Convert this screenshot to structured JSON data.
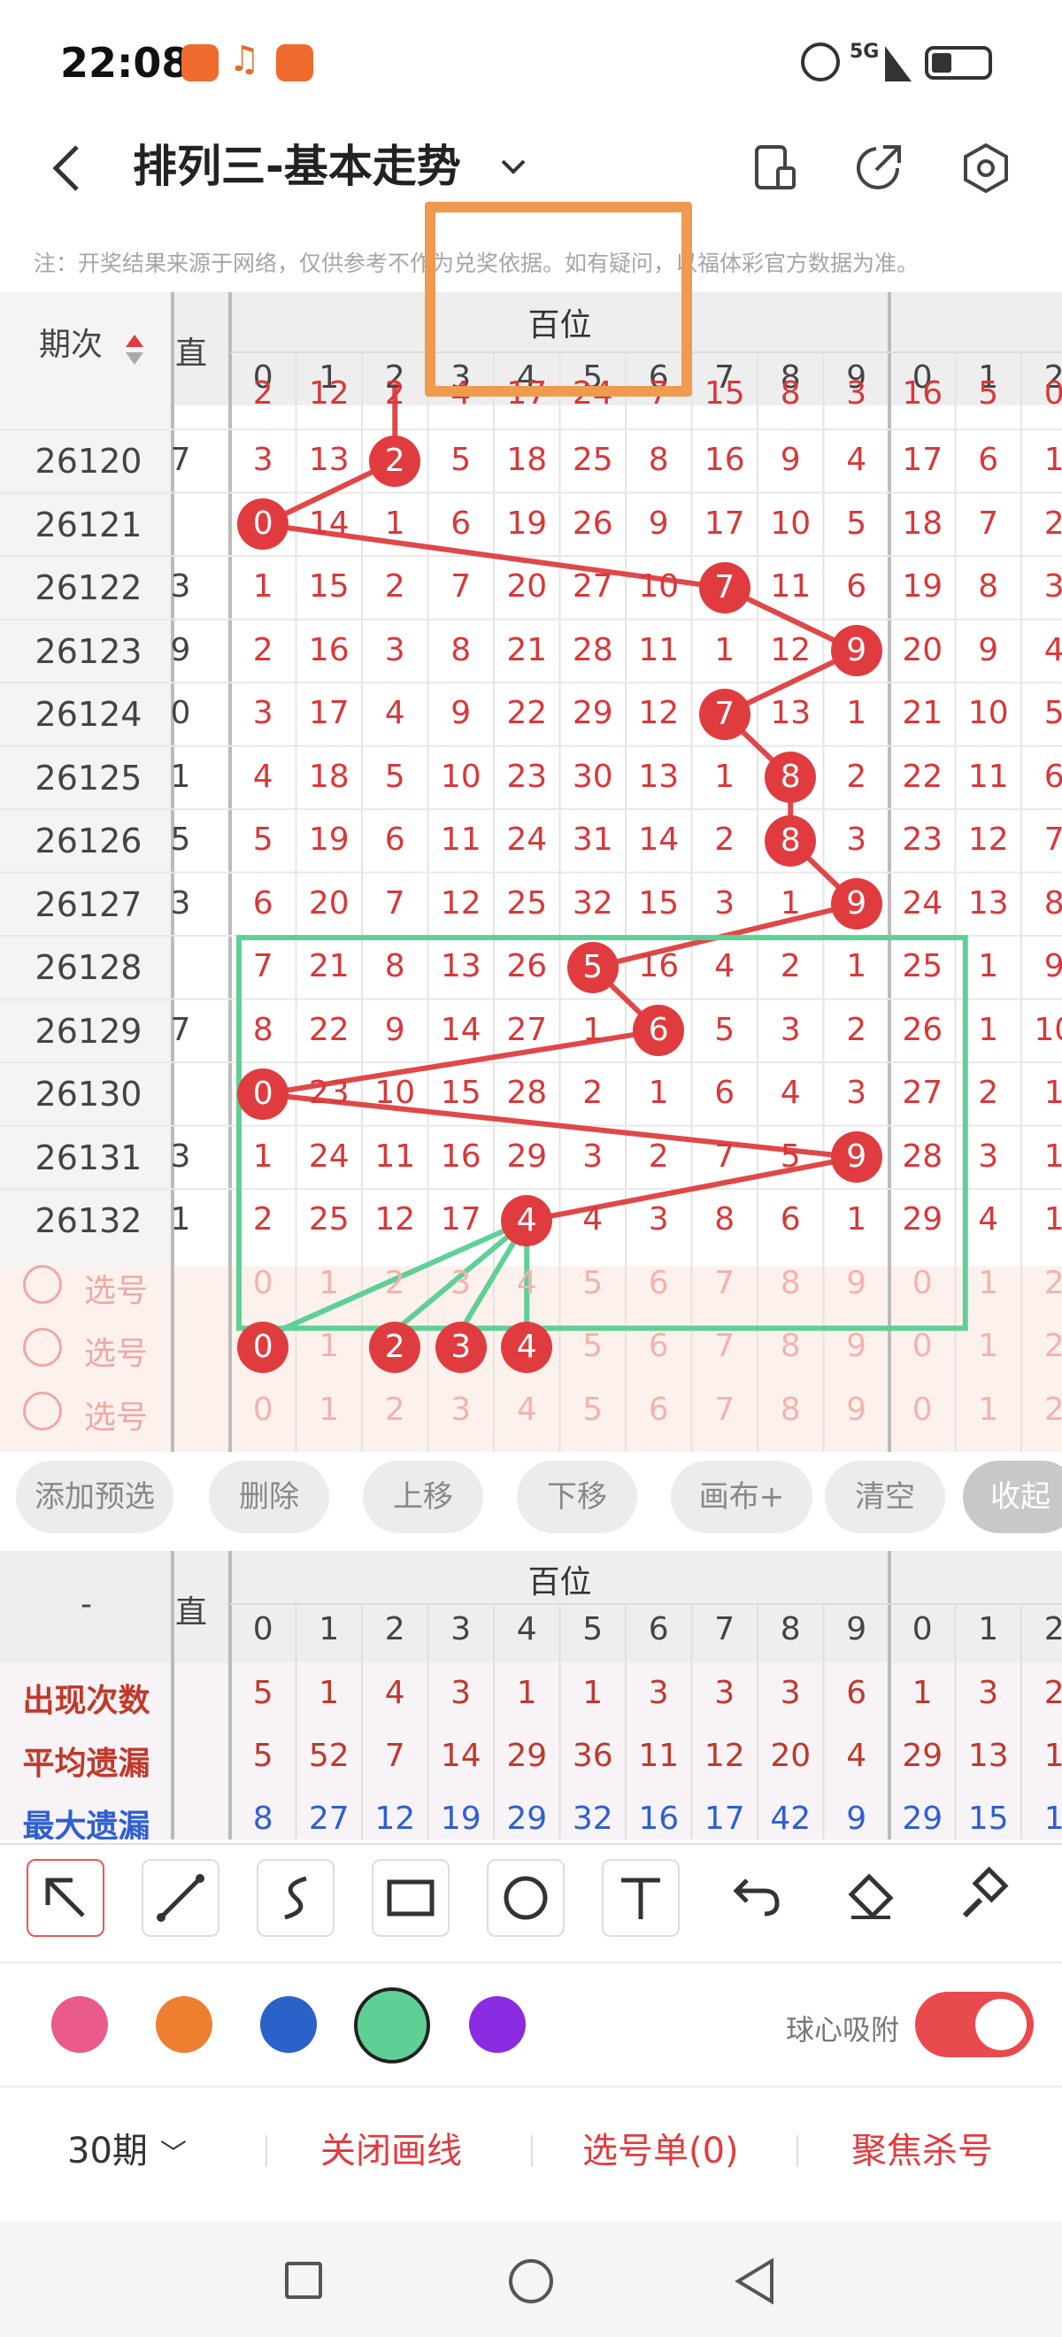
{
  "status_bar": {
    "time": "22:08",
    "network": "5G"
  },
  "header": {
    "title": "排列三-基本走势",
    "note": "注：开奖结果来源于网络，仅供参考不作为兑奖依据。如有疑问，以福体彩官方数据为准。"
  },
  "table": {
    "period_header": "期次",
    "zhi_header": "直",
    "section": "百位",
    "digits": [
      "0",
      "1",
      "2",
      "3",
      "4",
      "5",
      "6",
      "7",
      "8",
      "9"
    ],
    "next_digits": [
      "0",
      "1",
      "2"
    ],
    "partial_top": [
      "2",
      "12",
      "2",
      "4",
      "17",
      "24",
      "7",
      "15",
      "8",
      "3",
      "16",
      "5",
      "0"
    ],
    "rows": [
      {
        "period": "26120",
        "zhi": "7",
        "cells": [
          "3",
          "13",
          "2",
          "5",
          "18",
          "25",
          "8",
          "16",
          "9",
          "4",
          "17",
          "6",
          "1"
        ],
        "hit": 2
      },
      {
        "period": "26121",
        "zhi": "",
        "cells": [
          "0",
          "14",
          "1",
          "6",
          "19",
          "26",
          "9",
          "17",
          "10",
          "5",
          "18",
          "7",
          "2"
        ],
        "hit": 0
      },
      {
        "period": "26122",
        "zhi": "3",
        "cells": [
          "1",
          "15",
          "2",
          "7",
          "20",
          "27",
          "10",
          "7",
          "11",
          "6",
          "19",
          "8",
          "3"
        ],
        "hit": 7
      },
      {
        "period": "26123",
        "zhi": "9",
        "cells": [
          "2",
          "16",
          "3",
          "8",
          "21",
          "28",
          "11",
          "1",
          "12",
          "9",
          "20",
          "9",
          "4"
        ],
        "hit": 9
      },
      {
        "period": "26124",
        "zhi": "0",
        "cells": [
          "3",
          "17",
          "4",
          "9",
          "22",
          "29",
          "12",
          "7",
          "13",
          "1",
          "21",
          "10",
          "5"
        ],
        "hit": 7
      },
      {
        "period": "26125",
        "zhi": "1",
        "cells": [
          "4",
          "18",
          "5",
          "10",
          "23",
          "30",
          "13",
          "1",
          "8",
          "2",
          "22",
          "11",
          "6"
        ],
        "hit": 8
      },
      {
        "period": "26126",
        "zhi": "5",
        "cells": [
          "5",
          "19",
          "6",
          "11",
          "24",
          "31",
          "14",
          "2",
          "8",
          "3",
          "23",
          "12",
          "7"
        ],
        "hit": 8
      },
      {
        "period": "26127",
        "zhi": "3",
        "cells": [
          "6",
          "20",
          "7",
          "12",
          "25",
          "32",
          "15",
          "3",
          "1",
          "9",
          "24",
          "13",
          "8"
        ],
        "hit": 9
      },
      {
        "period": "26128",
        "zhi": "",
        "cells": [
          "7",
          "21",
          "8",
          "13",
          "26",
          "5",
          "16",
          "4",
          "2",
          "1",
          "25",
          "1",
          "9"
        ],
        "hit": 5
      },
      {
        "period": "26129",
        "zhi": "7",
        "cells": [
          "8",
          "22",
          "9",
          "14",
          "27",
          "1",
          "6",
          "5",
          "3",
          "2",
          "26",
          "1",
          "10"
        ],
        "hit": 6
      },
      {
        "period": "26130",
        "zhi": "",
        "cells": [
          "0",
          "23",
          "10",
          "15",
          "28",
          "2",
          "1",
          "6",
          "4",
          "3",
          "27",
          "2",
          "1"
        ],
        "hit": 0
      },
      {
        "period": "26131",
        "zhi": "3",
        "cells": [
          "1",
          "24",
          "11",
          "16",
          "29",
          "3",
          "2",
          "7",
          "5",
          "9",
          "28",
          "3",
          "1"
        ],
        "hit": 9
      },
      {
        "period": "26132",
        "zhi": "1",
        "cells": [
          "2",
          "25",
          "12",
          "17",
          "4",
          "4",
          "3",
          "8",
          "6",
          "1",
          "29",
          "4",
          "1"
        ],
        "hit": 4
      }
    ],
    "select_label": "选号",
    "select_rows": [
      [
        "0",
        "1",
        "2",
        "3",
        "4",
        "5",
        "6",
        "7",
        "8",
        "9",
        "0",
        "1",
        "2"
      ],
      [
        "0",
        "1",
        "2",
        "3",
        "4",
        "5",
        "6",
        "7",
        "8",
        "9",
        "0",
        "1",
        "2"
      ],
      [
        "0",
        "1",
        "2",
        "3",
        "4",
        "5",
        "6",
        "7",
        "8",
        "9",
        "0",
        "1",
        "2"
      ]
    ],
    "selected_balls": [
      "0",
      "2",
      "3",
      "4"
    ]
  },
  "actions": {
    "add": "添加预选",
    "delete": "删除",
    "up": "上移",
    "down": "下移",
    "canvas": "画布+",
    "clear": "清空",
    "collapse": "收起"
  },
  "stats": {
    "dash": "-",
    "zhi": "直",
    "section": "百位",
    "digits": [
      "0",
      "1",
      "2",
      "3",
      "4",
      "5",
      "6",
      "7",
      "8",
      "9",
      "0",
      "1",
      "2"
    ],
    "rows": [
      {
        "label": "出现次数",
        "values": [
          "5",
          "1",
          "4",
          "3",
          "1",
          "1",
          "3",
          "3",
          "3",
          "6",
          "1",
          "3",
          "2"
        ],
        "color": "#c0392b"
      },
      {
        "label": "平均遗漏",
        "values": [
          "5",
          "52",
          "7",
          "14",
          "29",
          "36",
          "11",
          "12",
          "20",
          "4",
          "29",
          "13",
          "1"
        ],
        "color": "#c0392b"
      },
      {
        "label": "最大遗漏",
        "values": [
          "8",
          "27",
          "12",
          "19",
          "29",
          "32",
          "16",
          "17",
          "42",
          "9",
          "29",
          "15",
          "1"
        ],
        "color": "#2f5fd0"
      }
    ]
  },
  "tools": [
    "arrow-tool-icon",
    "line-tool-icon",
    "curve-tool-icon",
    "rect-tool-icon",
    "circle-tool-icon",
    "text-tool-icon",
    "undo-icon",
    "eraser-icon",
    "brush-icon"
  ],
  "palette": [
    "#ea5a8a",
    "#ee7f2e",
    "#2a62c9",
    "#5fd095",
    "#8a2be2"
  ],
  "snap_label": "球心吸附",
  "bottom": {
    "periods": "30期",
    "close_draw": "关闭画线",
    "pick_list": "选号单(0)",
    "focus": "聚焦杀号"
  }
}
